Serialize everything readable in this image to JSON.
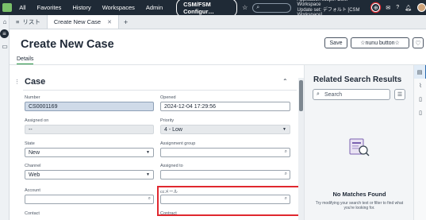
{
  "topnav": {
    "items": [
      "All",
      "Favorites",
      "History",
      "Workspaces",
      "Admin"
    ],
    "app_pill": "CSM/FSM Configur…",
    "scope_line1": "Application scope: CSM Workspace",
    "scope_line2": "Update set: デフォルト [CSM Workspace]"
  },
  "tabs": {
    "list_tab": "リスト",
    "active_tab": "Create New Case"
  },
  "header": {
    "title": "Create New Case",
    "save_label": "Save",
    "nunu_label": "☆nunu button☆",
    "subtab": "Details"
  },
  "form": {
    "section_title": "Case",
    "fields": {
      "number": {
        "label": "Number",
        "value": "CS0001169"
      },
      "opened": {
        "label": "Opened",
        "value": "2024-12-04 17:29:56"
      },
      "assigned_on": {
        "label": "Assigned on",
        "value": "--"
      },
      "priority": {
        "label": "Priority",
        "value": "4 - Low"
      },
      "state": {
        "label": "State",
        "value": "New"
      },
      "assignment_group": {
        "label": "Assignment group",
        "value": ""
      },
      "channel": {
        "label": "Channel",
        "value": "Web"
      },
      "assigned_to": {
        "label": "Assigned to",
        "value": ""
      },
      "account": {
        "label": "Account",
        "value": ""
      },
      "cc_mail": {
        "label": "ccメール",
        "value": ""
      },
      "contact": {
        "label": "Contact"
      },
      "contract": {
        "label": "Contract"
      }
    }
  },
  "related": {
    "title": "Related Search Results",
    "search_placeholder": "Search",
    "no_matches": "No Matches Found",
    "hint": "Try modifying your search text or filter to find what you're looking for."
  },
  "colors": {
    "nav_bg": "#1f2a36",
    "accent_green": "#1f8f3c",
    "highlight_red": "#e0282f"
  }
}
